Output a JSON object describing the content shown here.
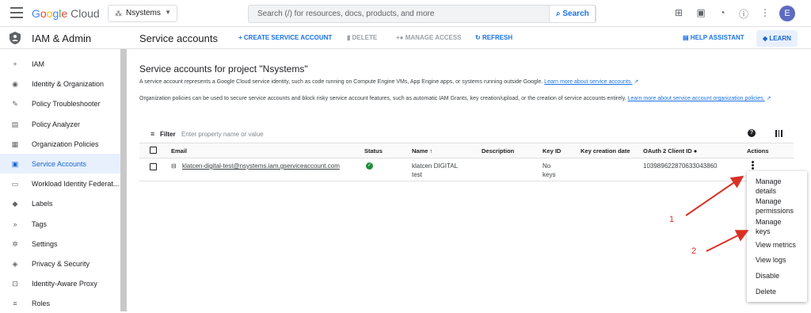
{
  "topbar": {
    "brand": "Google Cloud",
    "project": "Nsystems",
    "search_placeholder": "Search (/) for resources, docs, products, and more",
    "search_button": "Search",
    "avatar_letter": "E"
  },
  "sidebar": {
    "title": "IAM & Admin",
    "items": [
      {
        "label": "IAM",
        "icon": "person-add-icon"
      },
      {
        "label": "Identity & Organization",
        "icon": "account-circle-icon"
      },
      {
        "label": "Policy Troubleshooter",
        "icon": "wrench-icon"
      },
      {
        "label": "Policy Analyzer",
        "icon": "document-search-icon"
      },
      {
        "label": "Organization Policies",
        "icon": "list-box-icon"
      },
      {
        "label": "Service Accounts",
        "icon": "service-account-icon"
      },
      {
        "label": "Workload Identity Federat...",
        "icon": "id-card-icon"
      },
      {
        "label": "Labels",
        "icon": "label-icon"
      },
      {
        "label": "Tags",
        "icon": "tag-arrow-icon"
      },
      {
        "label": "Settings",
        "icon": "gear-icon"
      },
      {
        "label": "Privacy & Security",
        "icon": "shield-icon"
      },
      {
        "label": "Identity-Aware Proxy",
        "icon": "proxy-icon"
      },
      {
        "label": "Roles",
        "icon": "roles-icon"
      }
    ],
    "active_index": 5
  },
  "actionbar": {
    "title": "Service accounts",
    "create": "+ CREATE SERVICE ACCOUNT",
    "delete": "DELETE",
    "manage_access": "MANAGE ACCESS",
    "refresh": "REFRESH",
    "help_assistant": "HELP ASSISTANT",
    "learn": "LEARN"
  },
  "main": {
    "heading": "Service accounts for project \"Nsystems\"",
    "intro": "A service account represents a Google Cloud service identity, such as code running on Compute Engine VMs, App Engine apps, or systems running outside Google.",
    "intro_link": "Learn more about service accounts.",
    "policy_text": "Organization policies can be used to secure service accounts and block risky service account features, such as automatic IAM Grants, key creation/upload, or the creation of service accounts entirely.",
    "policy_link": "Learn more about service account organization policies."
  },
  "table": {
    "filter_label": "Filter",
    "filter_placeholder": "Enter property name or value",
    "headers": {
      "email": "Email",
      "status": "Status",
      "name": "Name",
      "description": "Description",
      "key_id": "Key ID",
      "key_date": "Key creation date",
      "oauth": "OAuth 2 Client ID",
      "actions": "Actions"
    },
    "row": {
      "email": "klatcen-digital-test@nsystems.iam.gserviceaccount.com",
      "name_line1": "klatcen DIGITAL",
      "name_line2": "test",
      "key_line1": "No",
      "key_line2": "keys",
      "oauth_id": "103989622870633043860"
    }
  },
  "actions_menu": {
    "items": [
      "Manage",
      "details",
      "Manage",
      "permissions",
      "Manage",
      "keys",
      "View metrics",
      "View logs",
      "Disable",
      "Delete"
    ]
  },
  "annotations": {
    "one": "1",
    "two": "2"
  },
  "colors": {
    "accent": "#1a73e8",
    "active_bg": "#e8f0fe",
    "status_ok": "#1e8e3e",
    "arrow": "#d93025"
  }
}
